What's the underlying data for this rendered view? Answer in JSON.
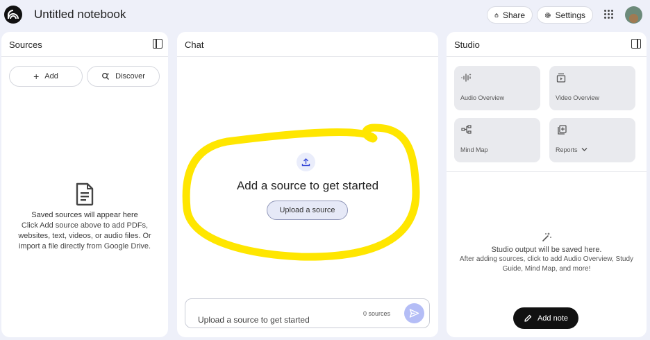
{
  "header": {
    "title": "Untitled notebook",
    "share_label": "Share",
    "settings_label": "Settings"
  },
  "sources": {
    "title": "Sources",
    "add_label": "Add",
    "discover_label": "Discover",
    "empty_heading": "Saved sources will appear here",
    "empty_body": "Click Add source above to add PDFs, websites, text, videos, or audio files. Or import a file directly from Google Drive."
  },
  "chat": {
    "title": "Chat",
    "heading": "Add a source to get started",
    "upload_button": "Upload a source",
    "input_placeholder": "Upload a source to get started",
    "source_count": "0 sources",
    "highlight_color": "#ffe600"
  },
  "studio": {
    "title": "Studio",
    "tiles": [
      {
        "label": "Audio Overview",
        "icon": "audio-waveform-icon"
      },
      {
        "label": "Video Overview",
        "icon": "video-icon"
      },
      {
        "label": "Mind Map",
        "icon": "mind-map-icon"
      },
      {
        "label": "Reports",
        "icon": "reports-icon"
      }
    ],
    "empty_heading": "Studio output will be saved here.",
    "empty_body": "After adding sources, click to add Audio Overview, Study Guide, Mind Map, and more!",
    "add_note_label": "Add note"
  },
  "colors": {
    "background": "#eef0f9",
    "accent": "#b4bdf6",
    "dark_button": "#111111"
  }
}
